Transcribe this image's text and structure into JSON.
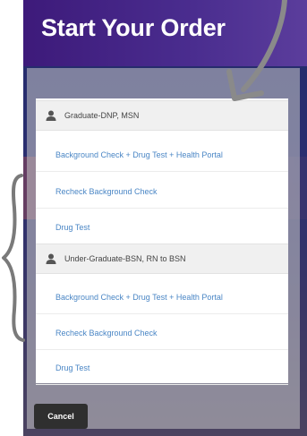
{
  "header": {
    "title": "Start Your Order"
  },
  "groups": [
    {
      "label": "Graduate-DNP, MSN",
      "icon": "person-icon",
      "options": [
        "Background Check + Drug Test + Health Portal",
        "Recheck Background Check",
        "Drug Test"
      ]
    },
    {
      "label": "Under-Graduate-BSN, RN to BSN",
      "icon": "person-icon",
      "options": [
        "Background Check + Drug Test + Health Portal",
        "Recheck Background Check",
        "Drug Test"
      ]
    }
  ],
  "footer": {
    "cancel_label": "Cancel"
  },
  "colors": {
    "header": "#4a2d8f",
    "link": "#4a86c5",
    "cancel": "#2f2f2f"
  }
}
